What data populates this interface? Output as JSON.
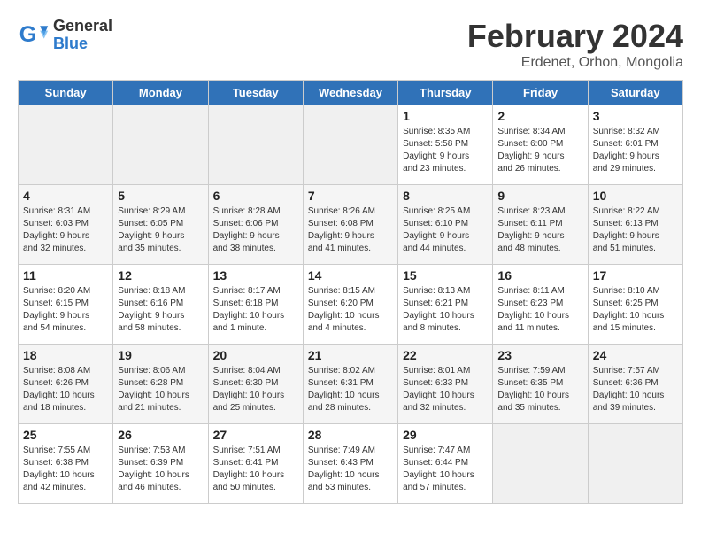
{
  "logo": {
    "general": "General",
    "blue": "Blue"
  },
  "title": "February 2024",
  "subtitle": "Erdenet, Orhon, Mongolia",
  "headers": [
    "Sunday",
    "Monday",
    "Tuesday",
    "Wednesday",
    "Thursday",
    "Friday",
    "Saturday"
  ],
  "weeks": [
    [
      {
        "day": "",
        "info": ""
      },
      {
        "day": "",
        "info": ""
      },
      {
        "day": "",
        "info": ""
      },
      {
        "day": "",
        "info": ""
      },
      {
        "day": "1",
        "info": "Sunrise: 8:35 AM\nSunset: 5:58 PM\nDaylight: 9 hours\nand 23 minutes."
      },
      {
        "day": "2",
        "info": "Sunrise: 8:34 AM\nSunset: 6:00 PM\nDaylight: 9 hours\nand 26 minutes."
      },
      {
        "day": "3",
        "info": "Sunrise: 8:32 AM\nSunset: 6:01 PM\nDaylight: 9 hours\nand 29 minutes."
      }
    ],
    [
      {
        "day": "4",
        "info": "Sunrise: 8:31 AM\nSunset: 6:03 PM\nDaylight: 9 hours\nand 32 minutes."
      },
      {
        "day": "5",
        "info": "Sunrise: 8:29 AM\nSunset: 6:05 PM\nDaylight: 9 hours\nand 35 minutes."
      },
      {
        "day": "6",
        "info": "Sunrise: 8:28 AM\nSunset: 6:06 PM\nDaylight: 9 hours\nand 38 minutes."
      },
      {
        "day": "7",
        "info": "Sunrise: 8:26 AM\nSunset: 6:08 PM\nDaylight: 9 hours\nand 41 minutes."
      },
      {
        "day": "8",
        "info": "Sunrise: 8:25 AM\nSunset: 6:10 PM\nDaylight: 9 hours\nand 44 minutes."
      },
      {
        "day": "9",
        "info": "Sunrise: 8:23 AM\nSunset: 6:11 PM\nDaylight: 9 hours\nand 48 minutes."
      },
      {
        "day": "10",
        "info": "Sunrise: 8:22 AM\nSunset: 6:13 PM\nDaylight: 9 hours\nand 51 minutes."
      }
    ],
    [
      {
        "day": "11",
        "info": "Sunrise: 8:20 AM\nSunset: 6:15 PM\nDaylight: 9 hours\nand 54 minutes."
      },
      {
        "day": "12",
        "info": "Sunrise: 8:18 AM\nSunset: 6:16 PM\nDaylight: 9 hours\nand 58 minutes."
      },
      {
        "day": "13",
        "info": "Sunrise: 8:17 AM\nSunset: 6:18 PM\nDaylight: 10 hours\nand 1 minute."
      },
      {
        "day": "14",
        "info": "Sunrise: 8:15 AM\nSunset: 6:20 PM\nDaylight: 10 hours\nand 4 minutes."
      },
      {
        "day": "15",
        "info": "Sunrise: 8:13 AM\nSunset: 6:21 PM\nDaylight: 10 hours\nand 8 minutes."
      },
      {
        "day": "16",
        "info": "Sunrise: 8:11 AM\nSunset: 6:23 PM\nDaylight: 10 hours\nand 11 minutes."
      },
      {
        "day": "17",
        "info": "Sunrise: 8:10 AM\nSunset: 6:25 PM\nDaylight: 10 hours\nand 15 minutes."
      }
    ],
    [
      {
        "day": "18",
        "info": "Sunrise: 8:08 AM\nSunset: 6:26 PM\nDaylight: 10 hours\nand 18 minutes."
      },
      {
        "day": "19",
        "info": "Sunrise: 8:06 AM\nSunset: 6:28 PM\nDaylight: 10 hours\nand 21 minutes."
      },
      {
        "day": "20",
        "info": "Sunrise: 8:04 AM\nSunset: 6:30 PM\nDaylight: 10 hours\nand 25 minutes."
      },
      {
        "day": "21",
        "info": "Sunrise: 8:02 AM\nSunset: 6:31 PM\nDaylight: 10 hours\nand 28 minutes."
      },
      {
        "day": "22",
        "info": "Sunrise: 8:01 AM\nSunset: 6:33 PM\nDaylight: 10 hours\nand 32 minutes."
      },
      {
        "day": "23",
        "info": "Sunrise: 7:59 AM\nSunset: 6:35 PM\nDaylight: 10 hours\nand 35 minutes."
      },
      {
        "day": "24",
        "info": "Sunrise: 7:57 AM\nSunset: 6:36 PM\nDaylight: 10 hours\nand 39 minutes."
      }
    ],
    [
      {
        "day": "25",
        "info": "Sunrise: 7:55 AM\nSunset: 6:38 PM\nDaylight: 10 hours\nand 42 minutes."
      },
      {
        "day": "26",
        "info": "Sunrise: 7:53 AM\nSunset: 6:39 PM\nDaylight: 10 hours\nand 46 minutes."
      },
      {
        "day": "27",
        "info": "Sunrise: 7:51 AM\nSunset: 6:41 PM\nDaylight: 10 hours\nand 50 minutes."
      },
      {
        "day": "28",
        "info": "Sunrise: 7:49 AM\nSunset: 6:43 PM\nDaylight: 10 hours\nand 53 minutes."
      },
      {
        "day": "29",
        "info": "Sunrise: 7:47 AM\nSunset: 6:44 PM\nDaylight: 10 hours\nand 57 minutes."
      },
      {
        "day": "",
        "info": ""
      },
      {
        "day": "",
        "info": ""
      }
    ]
  ]
}
